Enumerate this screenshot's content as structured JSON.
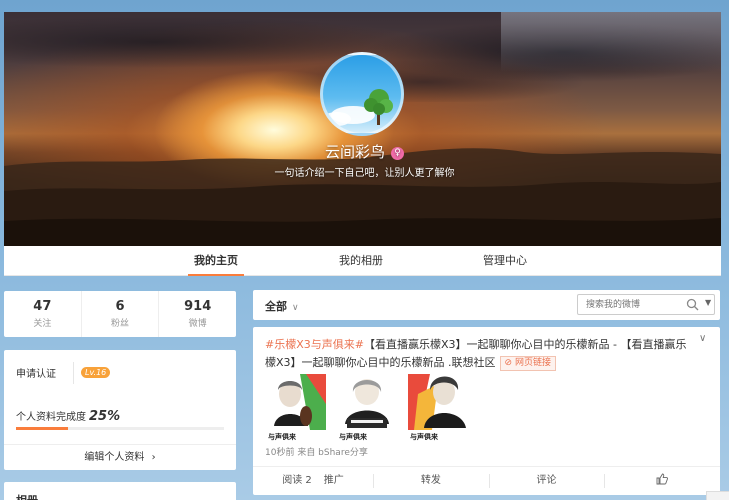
{
  "cover": {
    "username": "云间彩鸟",
    "bio": "一句话介绍一下自己吧，让别人更了解你"
  },
  "tabs": [
    {
      "label": "我的主页",
      "active": true
    },
    {
      "label": "我的相册",
      "active": false
    },
    {
      "label": "管理中心",
      "active": false
    }
  ],
  "stats": [
    {
      "num": "47",
      "label": "关注"
    },
    {
      "num": "6",
      "label": "粉丝"
    },
    {
      "num": "914",
      "label": "微博"
    }
  ],
  "profile": {
    "verify_label": "申请认证",
    "level": "Lv.16",
    "completion_label": "个人资料完成度",
    "completion_value": "25%",
    "completion_fraction": 0.25,
    "edit_label": "编辑个人资料",
    "edit_arrow": "›"
  },
  "album": {
    "title": "相册"
  },
  "filter": {
    "all_label": "全部",
    "chevron": "∨",
    "search_placeholder": "搜索我的微博"
  },
  "post": {
    "topic": "#乐檬X3与声俱来#",
    "body": "【看直播赢乐檬X3】一起聊聊你心目中的乐檬新品 - 【看直播赢乐檬X3】一起聊聊你心目中的乐檬新品 .联想社区",
    "link_label": "网页链接",
    "thumb_caption": "与声俱来",
    "meta": "10秒前 来自 bShare分享",
    "actions": {
      "read": "阅读 2",
      "promote": "推广",
      "forward": "转发",
      "comment": "评论"
    }
  },
  "colors": {
    "accent": "#fa7d3c",
    "topic": "#eb7350",
    "level_badge": "#f8a23a"
  }
}
